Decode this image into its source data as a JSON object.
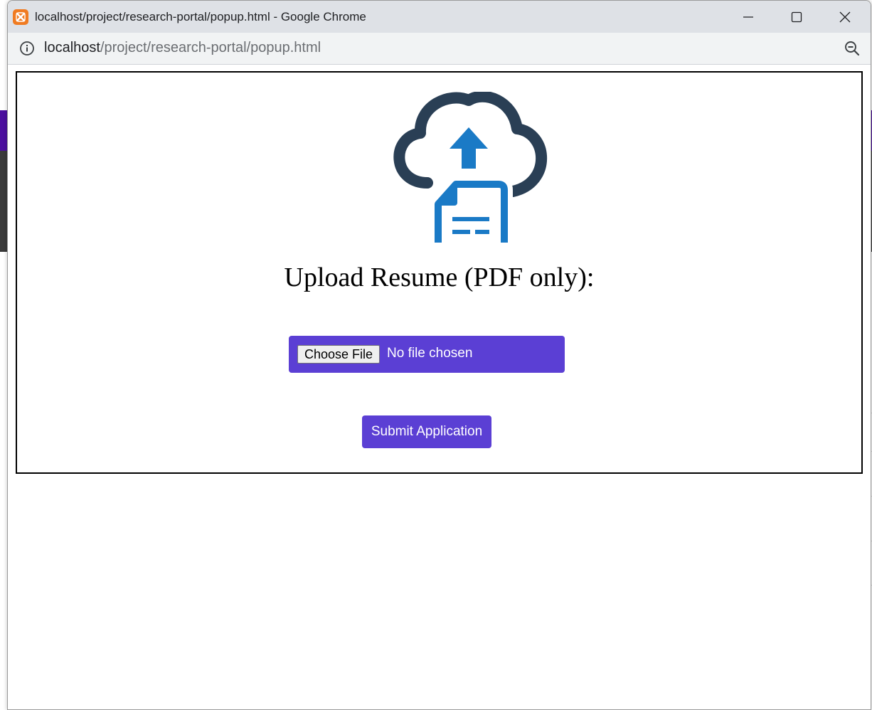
{
  "window": {
    "title": "localhost/project/research-portal/popup.html - Google Chrome",
    "controls": [
      "minimize",
      "maximize",
      "close"
    ]
  },
  "address_bar": {
    "host": "localhost",
    "path": "/project/research-portal/popup.html",
    "icons": [
      "info-icon",
      "zoom-icon"
    ]
  },
  "form": {
    "graphic": "cloud-upload-document-icon",
    "heading": "Upload Resume (PDF only):",
    "choose_file_label": "Choose File",
    "file_status": "No file chosen",
    "submit_label": "Submit Application"
  },
  "colors": {
    "accent": "#5b3fd4",
    "icon_dark": "#2a3f55",
    "icon_blue": "#1a7ac6",
    "app_icon": "#f07b21"
  }
}
